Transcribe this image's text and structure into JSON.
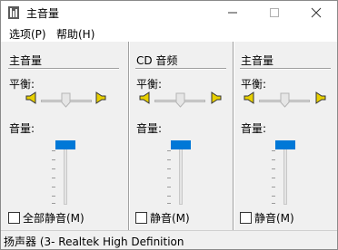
{
  "window": {
    "title": "主音量"
  },
  "menu": {
    "options": "选项(P)",
    "help": "帮助(H)"
  },
  "panels": [
    {
      "title": "主音量",
      "balance_label": "平衡:",
      "volume_label": "音量:",
      "mute_label": "全部静音(M)",
      "muted": false
    },
    {
      "title": "CD 音频",
      "balance_label": "平衡:",
      "volume_label": "音量:",
      "mute_label": "静音(M)",
      "muted": false
    },
    {
      "title": "主音量",
      "balance_label": "平衡:",
      "volume_label": "音量:",
      "mute_label": "静音(M)",
      "muted": false
    }
  ],
  "status": {
    "text": "扬声器 (3- Realtek High Definition"
  },
  "colors": {
    "accent": "#0078d7",
    "speaker": "#e8d000"
  }
}
